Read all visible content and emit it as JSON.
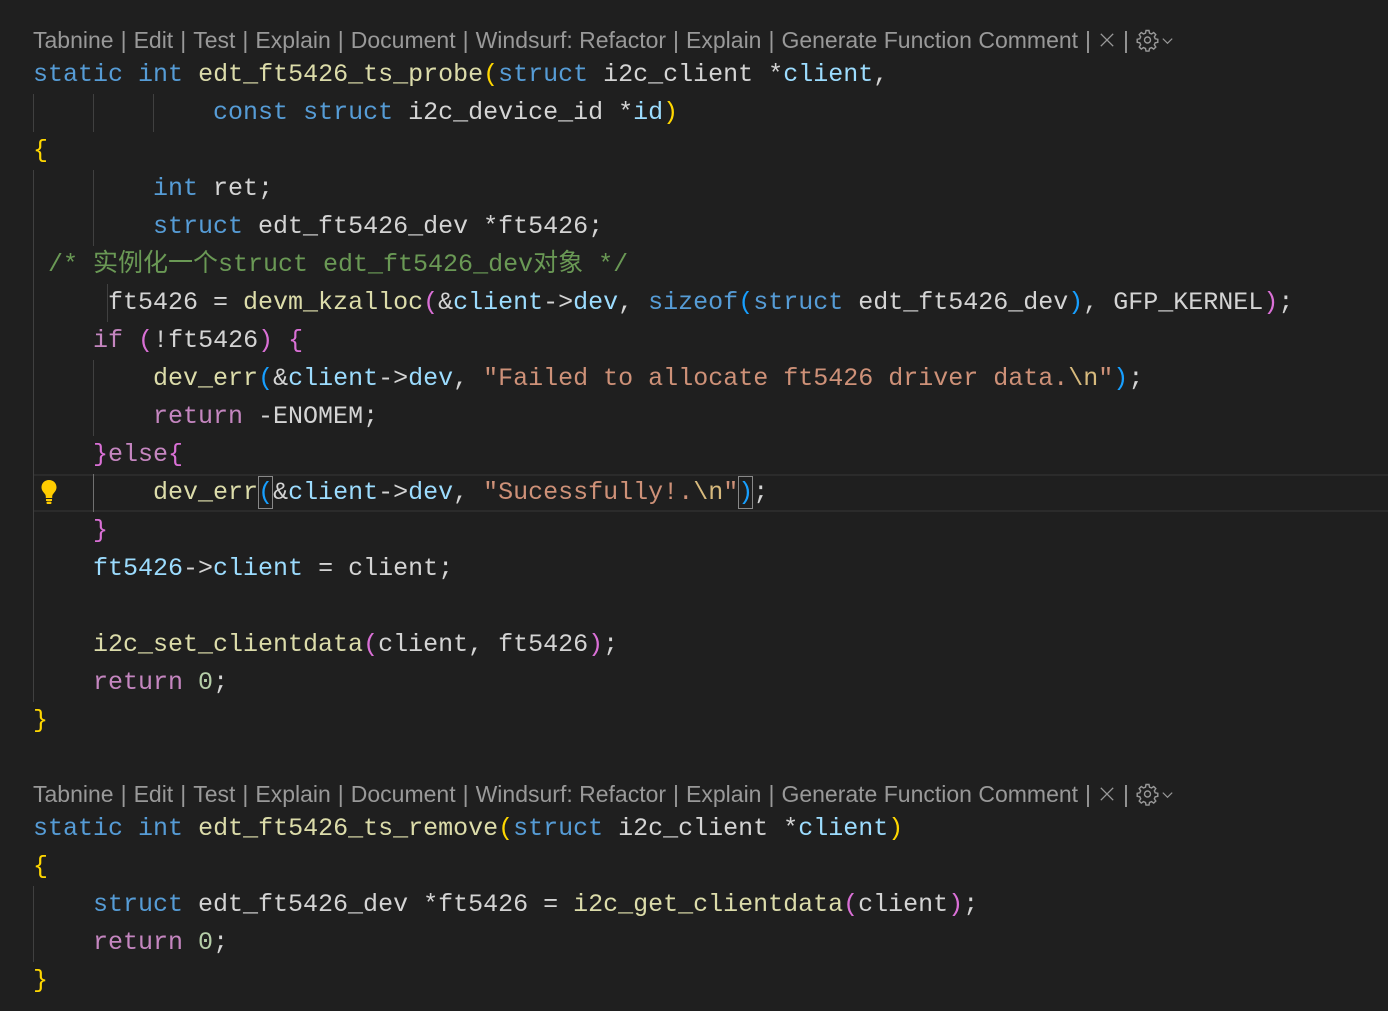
{
  "theme": {
    "background": "#1f1f1f",
    "foreground": "#d4d4d4",
    "keyword": "#569cd6",
    "control": "#c586c0",
    "function": "#dcdcaa",
    "variable": "#9cdcfe",
    "string": "#ce9178",
    "escape": "#d7ba7d",
    "comment": "#6a9955",
    "number": "#b5cea8",
    "bracket1": "#ffd700",
    "bracket2": "#da70d6",
    "bracket3": "#179fff",
    "bracket_match_border": "#888888",
    "codelens": "#999999",
    "indent_guide": "#404040",
    "indent_guide_active": "#707070",
    "line_highlight_border": "#2b2b2b",
    "lightbulb": "#ffcc00"
  },
  "codelens": {
    "actions": [
      "Tabnine",
      "Edit",
      "Test",
      "Explain",
      "Document",
      "Windsurf: Refactor",
      "Explain",
      "Generate Function Comment"
    ],
    "separator": "|",
    "close_icon": "close-icon",
    "settings_icon": "gear-icon",
    "menu_icon": "chevron-down-icon"
  },
  "lightbulb_icon": "lightbulb-icon",
  "blocks": [
    {
      "lines": [
        {
          "tokens": [
            [
              "static",
              "keyword"
            ],
            [
              " "
            ],
            [
              "int",
              "keyword"
            ],
            [
              " "
            ],
            [
              "edt_ft5426_ts_probe",
              "function"
            ],
            [
              "(",
              "bracket1"
            ],
            [
              "struct",
              "keyword"
            ],
            [
              " i2c_client *"
            ],
            [
              "client",
              "variable"
            ],
            [
              ","
            ]
          ]
        },
        {
          "tokens": [
            [
              "            "
            ],
            [
              "const",
              "keyword"
            ],
            [
              " "
            ],
            [
              "struct",
              "keyword"
            ],
            [
              " i2c_device_id *"
            ],
            [
              "id",
              "variable"
            ],
            [
              ")",
              "bracket1"
            ]
          ]
        },
        {
          "tokens": [
            [
              "{",
              "bracket1"
            ]
          ]
        },
        {
          "tokens": [
            [
              "        "
            ],
            [
              "int",
              "keyword"
            ],
            [
              " ret;"
            ]
          ]
        },
        {
          "tokens": [
            [
              "        "
            ],
            [
              "struct",
              "keyword"
            ],
            [
              " edt_ft5426_dev *ft5426;"
            ]
          ]
        },
        {
          "tokens": [
            [
              " "
            ],
            [
              "/* 实例化一个struct edt_ft5426_dev对象 */",
              "comment"
            ]
          ]
        },
        {
          "tokens": [
            [
              "     ft5426 = "
            ],
            [
              "devm_kzalloc",
              "function"
            ],
            [
              "(",
              "bracket2"
            ],
            [
              "&"
            ],
            [
              "client",
              "variable"
            ],
            [
              "->"
            ],
            [
              "dev",
              "variable"
            ],
            [
              ", "
            ],
            [
              "sizeof",
              "keyword"
            ],
            [
              "(",
              "bracket3"
            ],
            [
              "struct",
              "keyword"
            ],
            [
              " edt_ft5426_dev"
            ],
            [
              ")",
              "bracket3"
            ],
            [
              ", GFP_KERNEL"
            ],
            [
              ")",
              "bracket2"
            ],
            [
              ";"
            ]
          ]
        },
        {
          "tokens": [
            [
              "    "
            ],
            [
              "if",
              "control"
            ],
            [
              " "
            ],
            [
              "(",
              "bracket2"
            ],
            [
              "!ft5426"
            ],
            [
              ")",
              "bracket2"
            ],
            [
              " "
            ],
            [
              "{",
              "bracket2"
            ]
          ]
        },
        {
          "tokens": [
            [
              "        "
            ],
            [
              "dev_err",
              "function"
            ],
            [
              "(",
              "bracket3"
            ],
            [
              "&"
            ],
            [
              "client",
              "variable"
            ],
            [
              "->"
            ],
            [
              "dev",
              "variable"
            ],
            [
              ", "
            ],
            [
              "\"Failed to allocate ft5426 driver data.",
              "string"
            ],
            [
              "\\n",
              "escape"
            ],
            [
              "\"",
              "string"
            ],
            [
              ")",
              "bracket3"
            ],
            [
              ";"
            ]
          ]
        },
        {
          "tokens": [
            [
              "        "
            ],
            [
              "return",
              "control"
            ],
            [
              " -ENOMEM;"
            ]
          ]
        },
        {
          "tokens": [
            [
              "    "
            ],
            [
              "}",
              "bracket2"
            ],
            [
              "else",
              "control"
            ],
            [
              "{",
              "bracket2"
            ]
          ]
        },
        {
          "current": true,
          "lightbulb": true,
          "tokens": [
            [
              "        "
            ],
            [
              "dev_err",
              "function"
            ],
            [
              "(",
              "bracket3",
              "match"
            ],
            [
              "&"
            ],
            [
              "client",
              "variable"
            ],
            [
              "->"
            ],
            [
              "dev",
              "variable"
            ],
            [
              ", "
            ],
            [
              "\"Sucessfully!.",
              "string"
            ],
            [
              "\\n",
              "escape"
            ],
            [
              "\"",
              "string"
            ],
            [
              ")",
              "bracket3",
              "match"
            ],
            [
              ";"
            ]
          ]
        },
        {
          "tokens": [
            [
              "    "
            ],
            [
              "}",
              "bracket2"
            ]
          ]
        },
        {
          "tokens": [
            [
              "    "
            ],
            [
              "ft5426",
              "variable"
            ],
            [
              "->"
            ],
            [
              "client",
              "variable"
            ],
            [
              " = client;"
            ]
          ]
        },
        {
          "tokens": []
        },
        {
          "tokens": [
            [
              "    "
            ],
            [
              "i2c_set_clientdata",
              "function"
            ],
            [
              "(",
              "bracket2"
            ],
            [
              "client, ft5426"
            ],
            [
              ")",
              "bracket2"
            ],
            [
              ";"
            ]
          ]
        },
        {
          "tokens": [
            [
              "    "
            ],
            [
              "return",
              "control"
            ],
            [
              " "
            ],
            [
              "0",
              "number"
            ],
            [
              ";"
            ]
          ]
        },
        {
          "tokens": [
            [
              "}",
              "bracket1"
            ]
          ]
        },
        {
          "tokens": []
        }
      ]
    },
    {
      "lines": [
        {
          "tokens": [
            [
              "static",
              "keyword"
            ],
            [
              " "
            ],
            [
              "int",
              "keyword"
            ],
            [
              " "
            ],
            [
              "edt_ft5426_ts_remove",
              "function"
            ],
            [
              "(",
              "bracket1"
            ],
            [
              "struct",
              "keyword"
            ],
            [
              " i2c_client *"
            ],
            [
              "client",
              "variable"
            ],
            [
              ")",
              "bracket1"
            ]
          ]
        },
        {
          "tokens": [
            [
              "{",
              "bracket1"
            ]
          ]
        },
        {
          "tokens": [
            [
              "    "
            ],
            [
              "struct",
              "keyword"
            ],
            [
              " edt_ft5426_dev *ft5426 = "
            ],
            [
              "i2c_get_clientdata",
              "function"
            ],
            [
              "(",
              "bracket2"
            ],
            [
              "client"
            ],
            [
              ")",
              "bracket2"
            ],
            [
              ";"
            ]
          ]
        },
        {
          "tokens": [
            [
              "    "
            ],
            [
              "return",
              "control"
            ],
            [
              " "
            ],
            [
              "0",
              "number"
            ],
            [
              ";"
            ]
          ]
        },
        {
          "tokens": [
            [
              "}",
              "bracket1"
            ]
          ]
        }
      ]
    }
  ]
}
